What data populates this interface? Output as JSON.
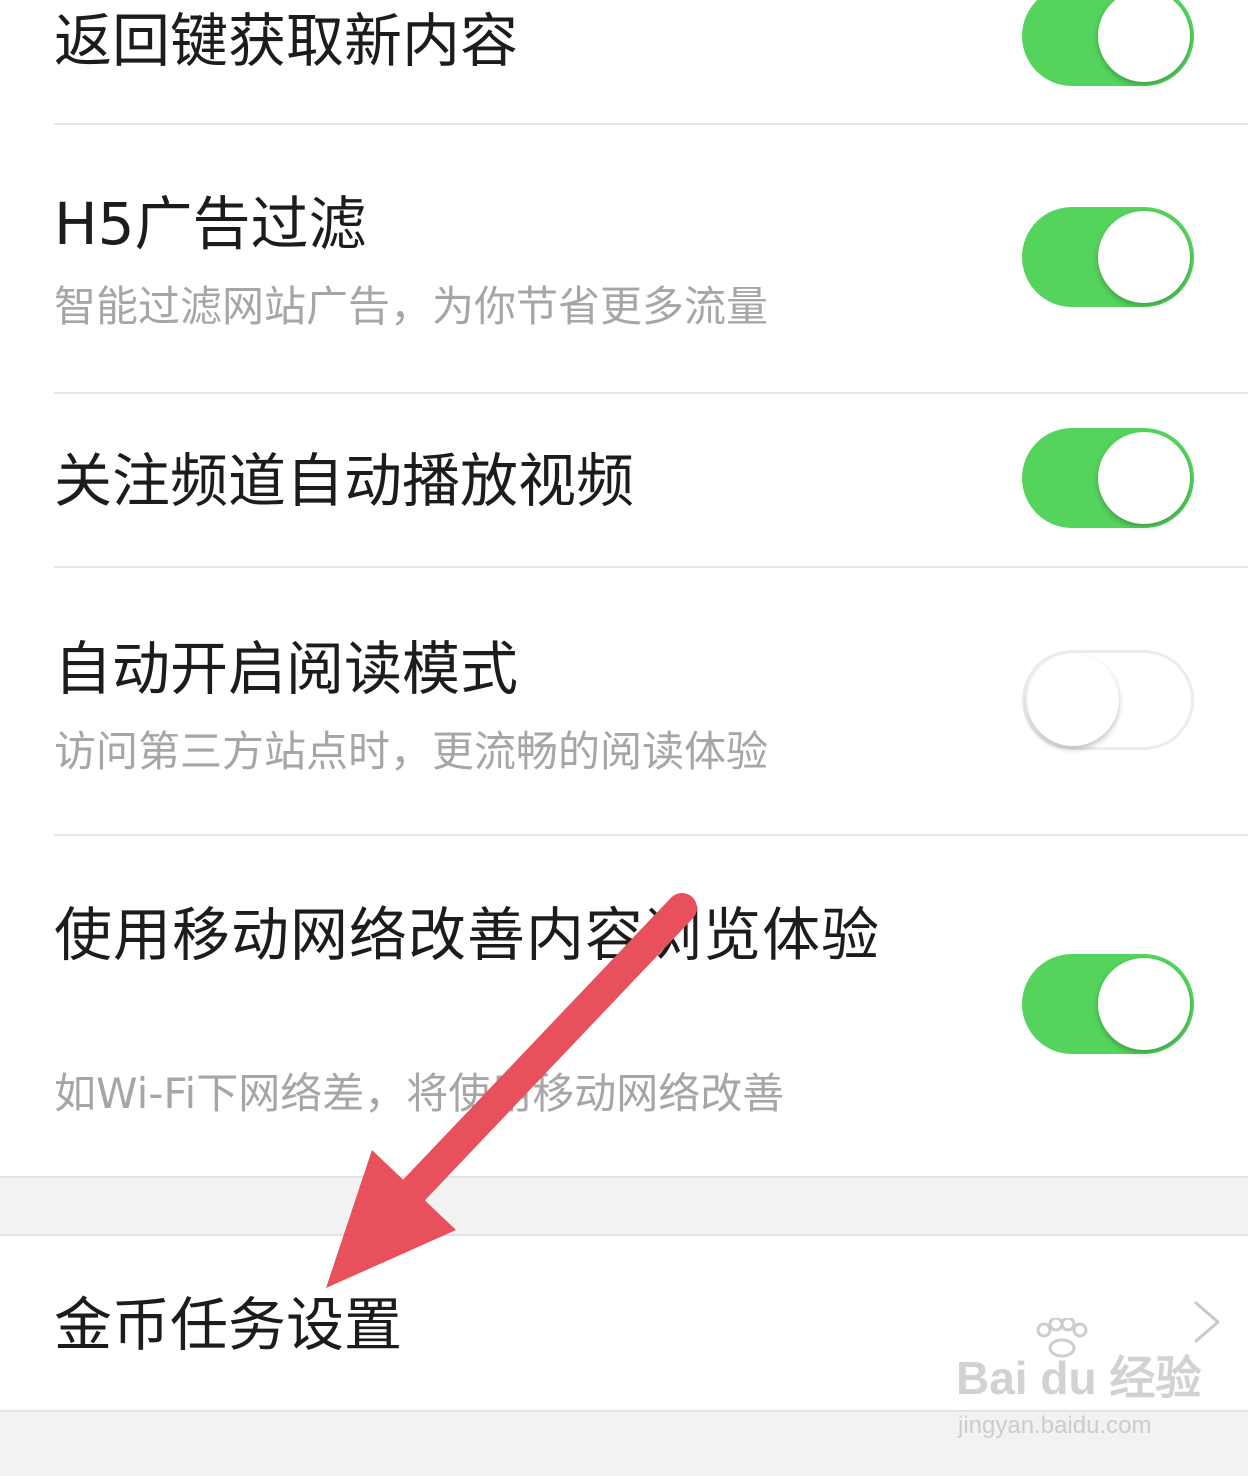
{
  "settings": {
    "rows": [
      {
        "title": "返回键获取新内容",
        "subtitle": "",
        "toggle": "on"
      },
      {
        "title": "H5广告过滤",
        "subtitle": "智能过滤网站广告，为你节省更多流量",
        "toggle": "on"
      },
      {
        "title": "关注频道自动播放视频",
        "subtitle": "",
        "toggle": "on"
      },
      {
        "title": "自动开启阅读模式",
        "subtitle": "访问第三方站点时，更流畅的阅读体验",
        "toggle": "off"
      },
      {
        "title": "使用移动网络改善内容浏览体验",
        "subtitle": "如Wi-Fi下网络差，将使用移动网络改善",
        "toggle": "on"
      }
    ],
    "nav_row": {
      "title": "金币任务设置",
      "icon": "chevron-right-icon"
    }
  },
  "annotation": {
    "color": "#e8505b",
    "icon": "red-arrow"
  },
  "watermark": {
    "brand": "Bai du 经验",
    "site": "jingyan.baidu.com"
  },
  "colors": {
    "toggle_on": "#54d45c",
    "subtitle": "#a6a6a6",
    "background": "#ffffff"
  }
}
